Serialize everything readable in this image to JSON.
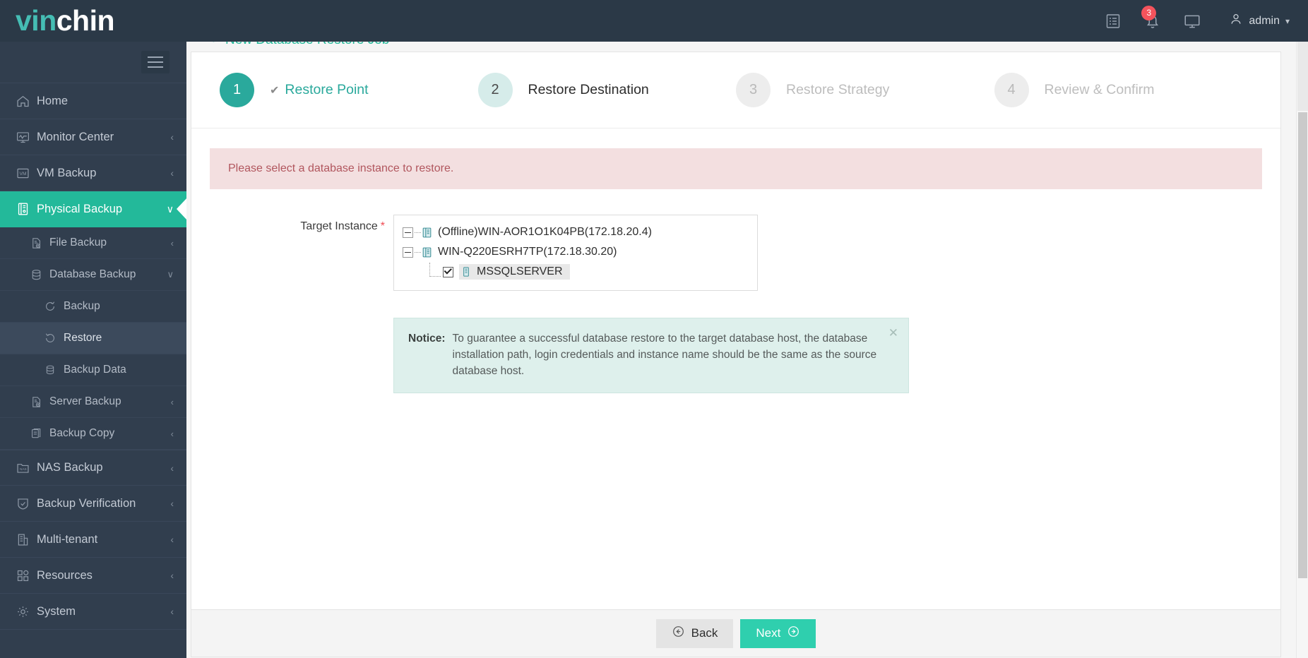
{
  "brand": {
    "part1": "vin",
    "part2": "chin",
    "accent": "#45bdb4"
  },
  "header": {
    "icons": [
      {
        "name": "log-list-icon",
        "title": "Logs"
      },
      {
        "name": "notification-bell-icon",
        "title": "Alerts",
        "badge": "3"
      },
      {
        "name": "monitor-icon",
        "title": "Console"
      }
    ],
    "user": {
      "label": "admin",
      "chevron": "⌄"
    }
  },
  "sidebar": {
    "toggle": "hamburger-menu",
    "items": [
      {
        "label": "Home",
        "icon": "home-icon",
        "arrow": "",
        "level": 1,
        "state": "normal"
      },
      {
        "label": "Monitor Center",
        "icon": "monitor-center-icon",
        "arrow": "‹",
        "level": 1,
        "state": "normal"
      },
      {
        "label": "VM Backup",
        "icon": "vm-icon",
        "arrow": "‹",
        "level": 1,
        "state": "normal"
      },
      {
        "label": "Physical Backup",
        "icon": "physical-backup-icon",
        "arrow": "∨",
        "level": 1,
        "state": "active"
      },
      {
        "label": "File Backup",
        "icon": "file-backup-icon",
        "arrow": "‹",
        "level": 2,
        "state": "normal"
      },
      {
        "label": "Database Backup",
        "icon": "database-icon",
        "arrow": "∨",
        "level": 2,
        "state": "normal"
      },
      {
        "label": "Backup",
        "icon": "backup-refresh-icon",
        "arrow": "",
        "level": 3,
        "state": "normal"
      },
      {
        "label": "Restore",
        "icon": "restore-icon",
        "arrow": "",
        "level": 3,
        "state": "selected"
      },
      {
        "label": "Backup Data",
        "icon": "backup-data-icon",
        "arrow": "",
        "level": 3,
        "state": "normal"
      },
      {
        "label": "Server Backup",
        "icon": "server-backup-icon",
        "arrow": "‹",
        "level": 2,
        "state": "normal"
      },
      {
        "label": "Backup Copy",
        "icon": "backup-copy-icon",
        "arrow": "‹",
        "level": 2,
        "state": "normal"
      },
      {
        "label": "NAS Backup",
        "icon": "nas-icon",
        "arrow": "‹",
        "level": 1,
        "state": "normal"
      },
      {
        "label": "Backup Verification",
        "icon": "shield-check-icon",
        "arrow": "‹",
        "level": 1,
        "state": "normal"
      },
      {
        "label": "Multi-tenant",
        "icon": "building-icon",
        "arrow": "‹",
        "level": 1,
        "state": "normal"
      },
      {
        "label": "Resources",
        "icon": "resources-grid-icon",
        "arrow": "‹",
        "level": 1,
        "state": "normal"
      },
      {
        "label": "System",
        "icon": "gear-icon",
        "arrow": "‹",
        "level": 1,
        "state": "normal"
      }
    ]
  },
  "page": {
    "title": "New Database Restore Job",
    "steps": [
      {
        "num": "1",
        "label": "Restore Point",
        "state": "done",
        "tick": "✔"
      },
      {
        "num": "2",
        "label": "Restore Destination",
        "state": "active",
        "tick": ""
      },
      {
        "num": "3",
        "label": "Restore Strategy",
        "state": "todo",
        "tick": ""
      },
      {
        "num": "4",
        "label": "Review & Confirm",
        "state": "todo",
        "tick": ""
      }
    ],
    "error_message": "Please select a database instance to restore.",
    "form": {
      "target_instance_label": "Target Instance",
      "required_mark": "*",
      "tree": [
        {
          "label": "(Offline)WIN-AOR1O1K04PB(172.18.20.4)",
          "level": 1,
          "expanded": true,
          "checked": false,
          "selected": false,
          "icon": "host-server-icon"
        },
        {
          "label": "WIN-Q220ESRH7TP(172.18.30.20)",
          "level": 1,
          "expanded": true,
          "checked": false,
          "selected": false,
          "icon": "host-server-icon"
        },
        {
          "label": "MSSQLSERVER",
          "level": 2,
          "expanded": false,
          "checked": true,
          "selected": true,
          "icon": "db-instance-icon"
        }
      ]
    },
    "notice": {
      "label": "Notice:",
      "text": "To guarantee a successful database restore to the target database host, the database installation path, login credentials and instance name should be the same as the source database host.",
      "close": "✕"
    },
    "footer": {
      "back_label": "Back",
      "next_label": "Next"
    }
  },
  "colors": {
    "accent_teal": "#23b99a",
    "step_done": "#2aa99c",
    "next_button": "#2fcfae",
    "error_bg": "#f3dfe0",
    "error_text": "#b1565e",
    "notice_bg": "#def0ec",
    "sidebar_bg": "#313e4e",
    "header_bg": "#2b3947",
    "badge_red": "#f4535c"
  }
}
